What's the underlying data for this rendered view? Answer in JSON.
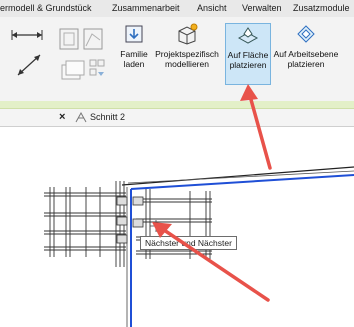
{
  "ribbon_tabs": [
    "ermodell & Grundstück",
    "Zusammenarbeit",
    "Ansicht",
    "Verwalten",
    "Zusatzmodule"
  ],
  "ribbon_buttons": {
    "family_load": {
      "line1": "Familie",
      "line2": "laden"
    },
    "project_model": {
      "line1": "Projektspezifisch",
      "line2": "modellieren"
    },
    "place_on_face": {
      "line1": "Auf Fläche",
      "line2": "platzieren"
    },
    "place_on_workplane": {
      "line1": "Auf Arbeitsebene",
      "line2": "platzieren"
    }
  },
  "view_tab": {
    "close": "×",
    "name": "Schnitt 2"
  },
  "tooltip": "Nächster und Nächster",
  "colors": {
    "active_button": "#cde6f7",
    "arrow": "#e8524a",
    "wall_edge": "#1f4fd6"
  }
}
